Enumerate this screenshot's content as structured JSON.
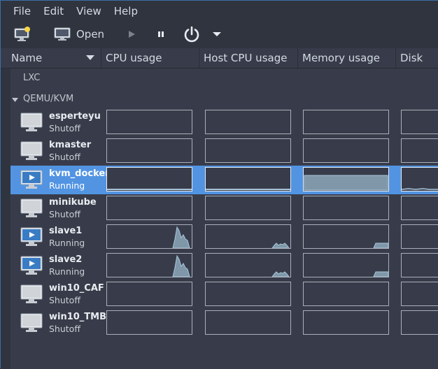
{
  "menubar": {
    "items": [
      "File",
      "Edit",
      "View",
      "Help"
    ]
  },
  "toolbar": {
    "open_label": "Open"
  },
  "columns": [
    "Name",
    "CPU usage",
    "Host CPU usage",
    "Memory usage",
    "Disk I/O"
  ],
  "groups": [
    "LXC",
    "QEMU/KVM"
  ],
  "vms": [
    {
      "name": "esperteyu",
      "status": "Shutoff"
    },
    {
      "name": "kmaster",
      "status": "Shutoff"
    },
    {
      "name": "kvm_docker",
      "status": "Running"
    },
    {
      "name": "minikube",
      "status": "Shutoff"
    },
    {
      "name": "slave1",
      "status": "Running"
    },
    {
      "name": "slave2",
      "status": "Running"
    },
    {
      "name": "win10_CAF",
      "status": "Shutoff"
    },
    {
      "name": "win10_TMB",
      "status": "Shutoff"
    }
  ],
  "colors": {
    "selection": "#5294e2",
    "graph_fill": "#7f97a8",
    "graph_line": "#a8c7dc"
  }
}
